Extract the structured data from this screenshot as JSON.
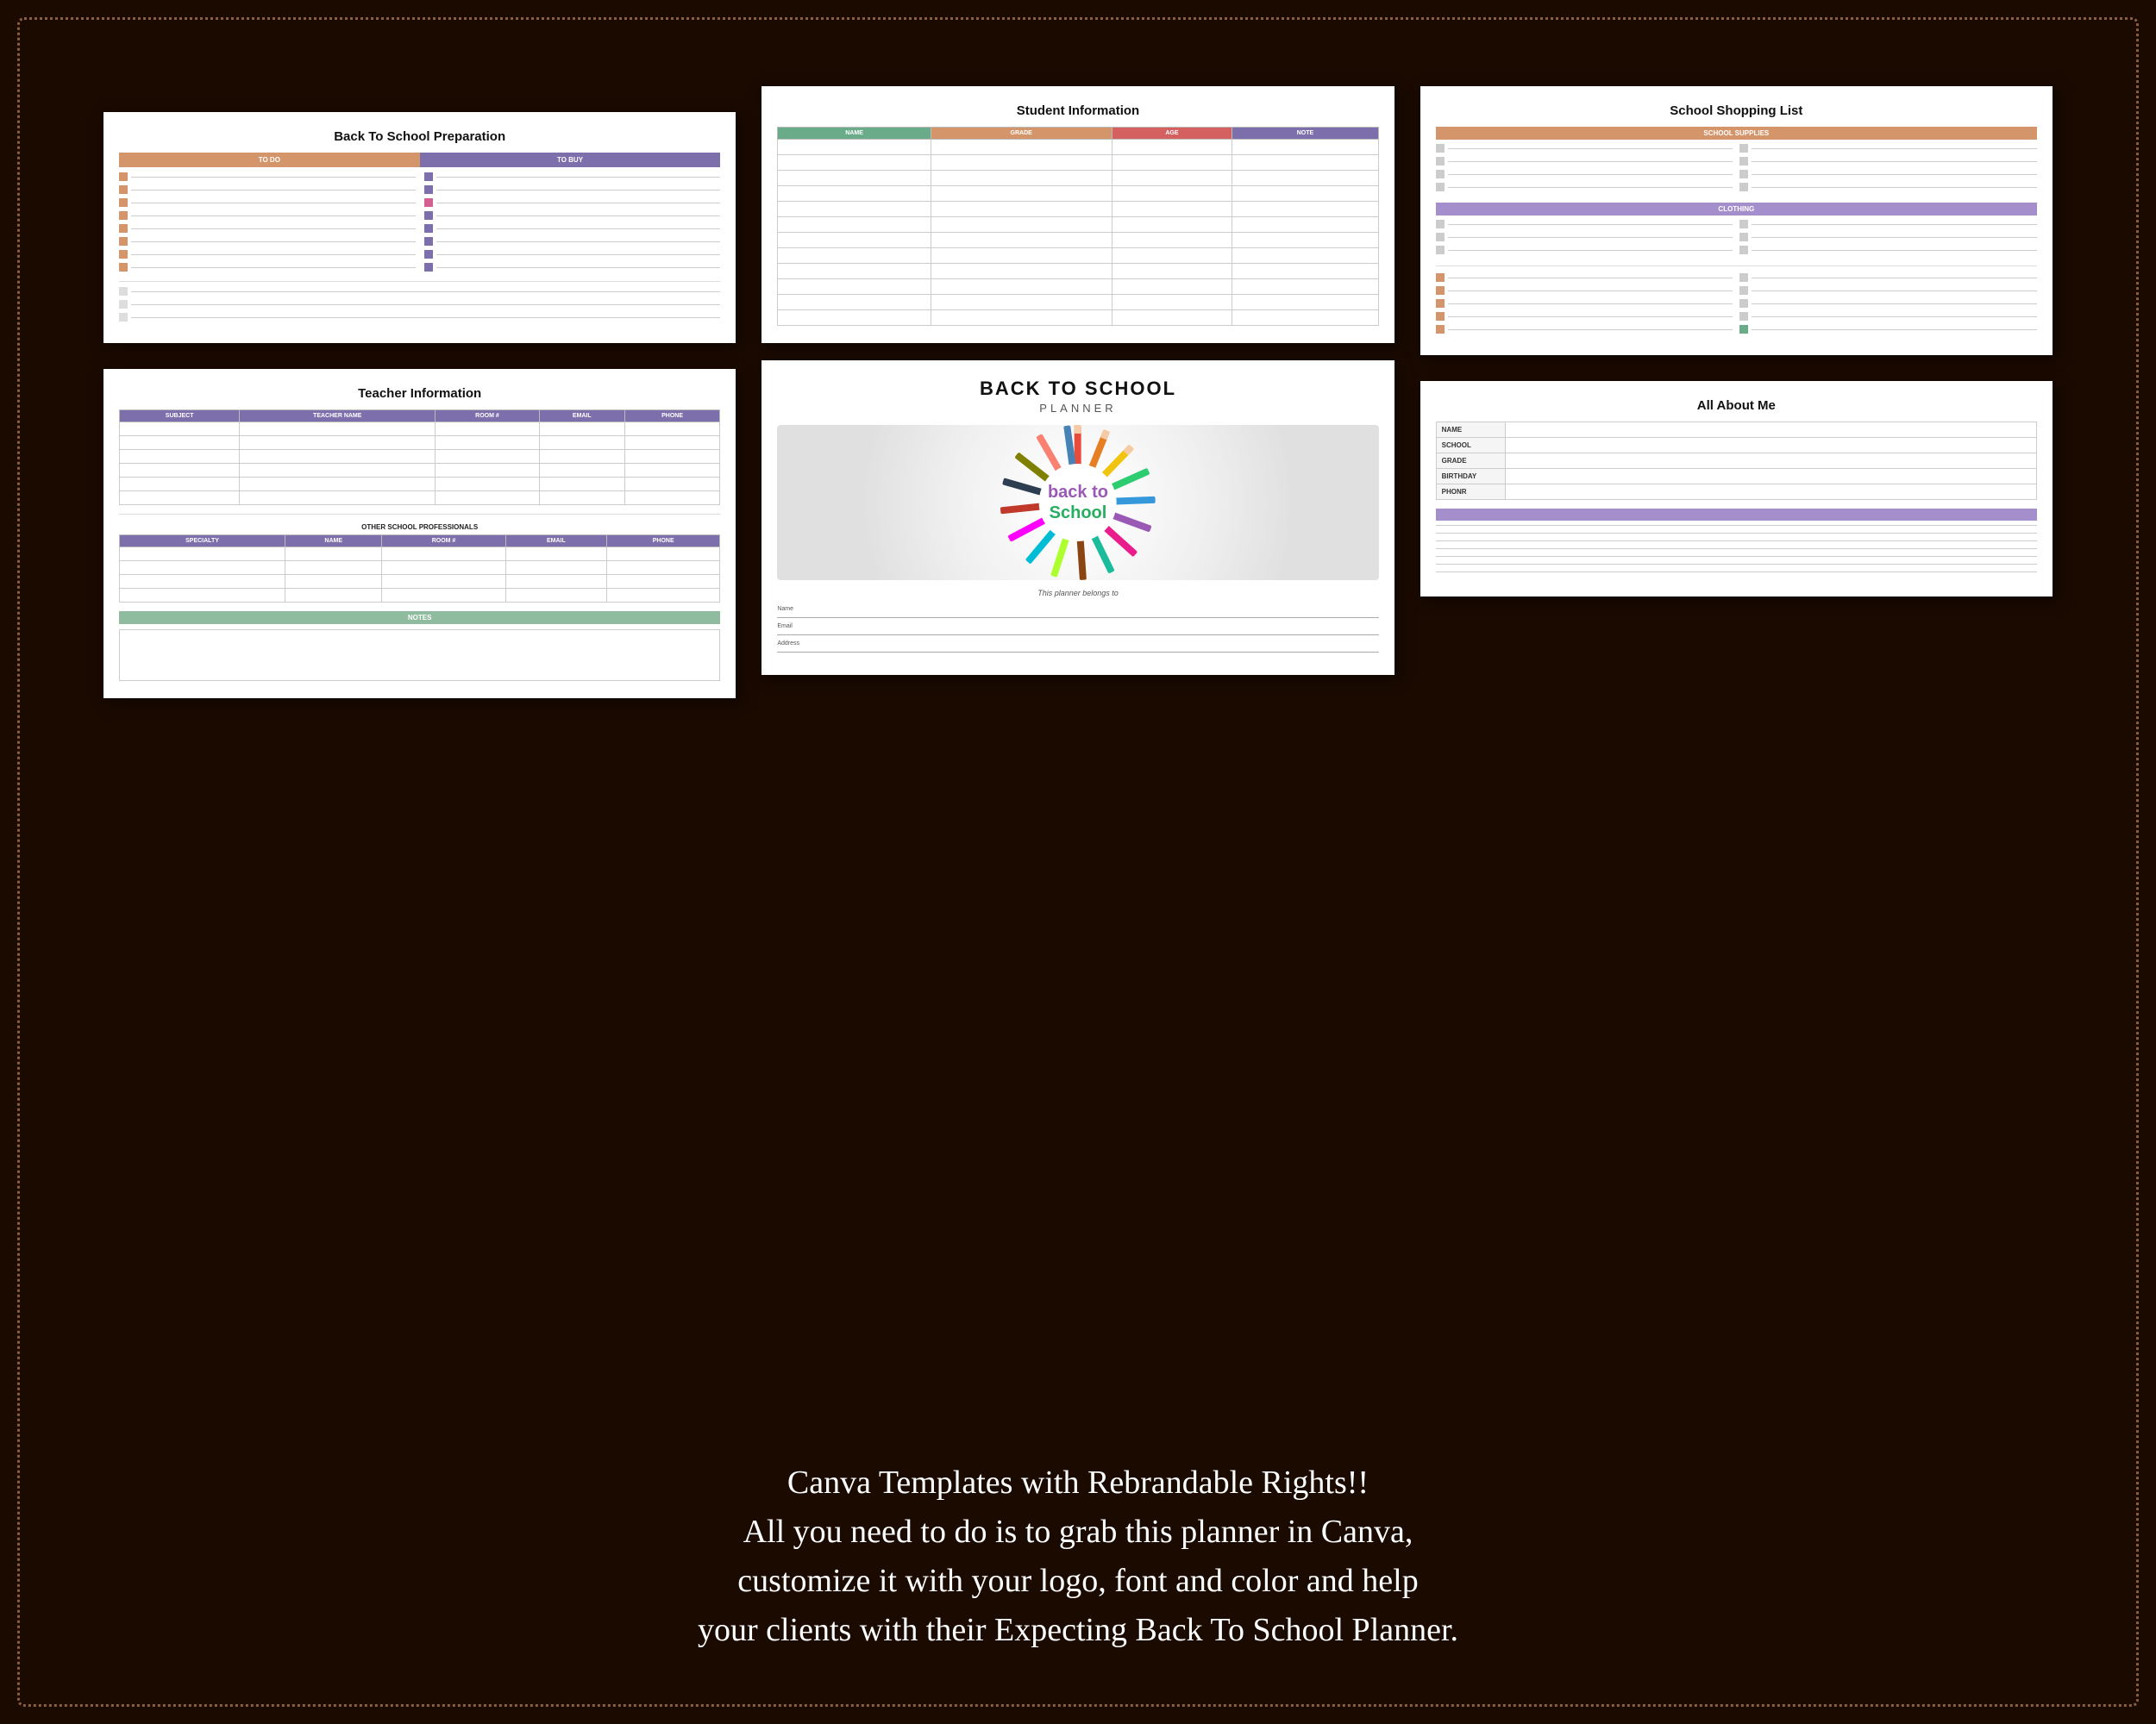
{
  "background": "#1a0a00",
  "border_color": "#8B6040",
  "pages": {
    "prep": {
      "title": "Back To School Preparation",
      "todo_label": "TO DO",
      "tobuy_label": "TO BUY"
    },
    "teacher": {
      "title": "Teacher Information",
      "columns": [
        "SUBJECT",
        "TEACHER NAME",
        "ROOM #",
        "EMAIL",
        "PHONE"
      ],
      "other_label": "OTHER SCHOOL PROFESSIONALS",
      "other_cols": [
        "SPECIALTY",
        "NAME",
        "ROOM #",
        "EMAIL",
        "PHONE"
      ],
      "notes_label": "NOTES"
    },
    "student": {
      "title": "Student Information",
      "columns": [
        "NAME",
        "GRADE",
        "AGE",
        "NOTE"
      ]
    },
    "cover": {
      "main_title": "BACK TO SCHOOL",
      "sub_title": "PLANNER",
      "center_text_1": "back to",
      "center_text_2": "School",
      "belongs_text": "This planner belongs to",
      "name_label": "Name",
      "email_label": "Email",
      "address_label": "Address"
    },
    "shopping": {
      "title": "School Shopping List",
      "supplies_label": "SCHOOL SUPPLIES",
      "clothing_label": "CLOTHING"
    },
    "about": {
      "title": "All About Me",
      "fields": [
        "NAME",
        "SCHOOL",
        "GRADE",
        "BIRTHDAY",
        "PHONR"
      ]
    }
  },
  "bottom_text": {
    "line1": "Canva Templates with Rebrandable Rights!!",
    "line2": "All you need to do is to grab this planner in Canva,",
    "line3": "customize it with your logo, font and color and help",
    "line4": "your clients with their Expecting Back To School Planner."
  }
}
